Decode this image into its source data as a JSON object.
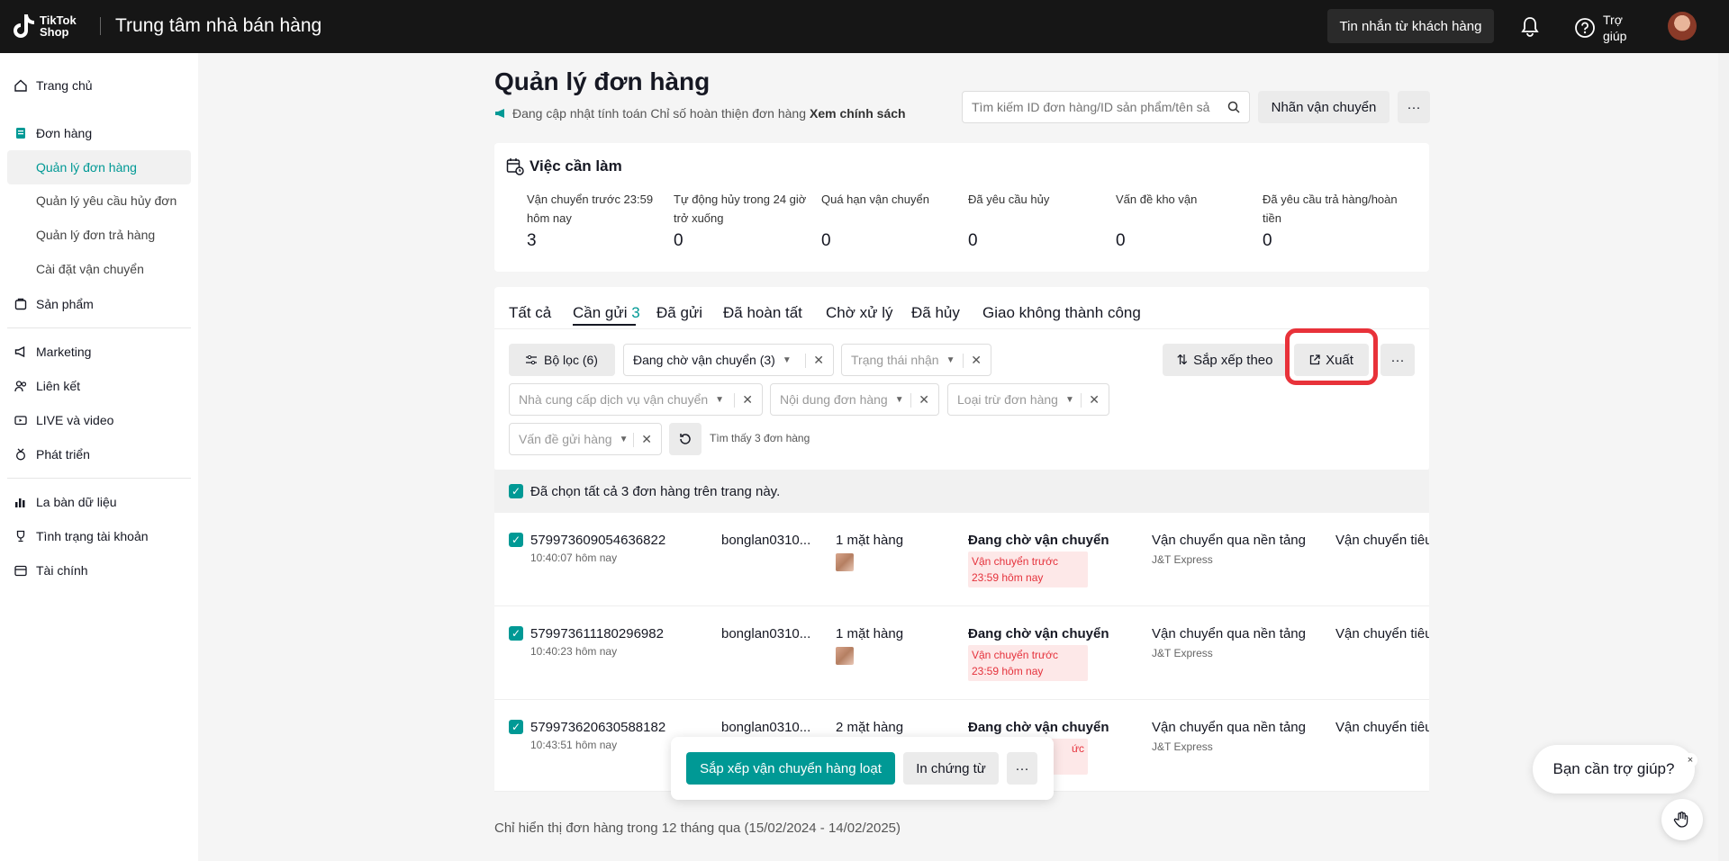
{
  "topbar": {
    "logo_line1": "TikTok",
    "logo_line2": "Shop",
    "title": "Trung tâm nhà bán hàng",
    "messages_button": "Tin nhắn từ khách hàng",
    "help_line1": "Trợ",
    "help_line2": "giúp"
  },
  "sidebar": {
    "home": "Trang chủ",
    "orders": "Đơn hàng",
    "order_sub": [
      "Quản lý đơn hàng",
      "Quản lý yêu cầu hủy đơn",
      "Quản lý đơn trả hàng",
      "Cài đặt vận chuyển"
    ],
    "products": "Sản phẩm",
    "marketing": "Marketing",
    "affiliate": "Liên kết",
    "live": "LIVE và video",
    "growth": "Phát triển",
    "data_compass": "La bàn dữ liệu",
    "account_health": "Tình trạng tài khoản",
    "finance": "Tài chính"
  },
  "header": {
    "title": "Quản lý đơn hàng",
    "notice": "Đang cập nhật tính toán Chỉ số hoàn thiện đơn hàng",
    "notice_link": "Xem chính sách",
    "search_placeholder": "Tìm kiếm ID đơn hàng/ID sản phẩm/tên sả",
    "shipping_label_button": "Nhãn vận chuyển",
    "more": "···"
  },
  "todo": {
    "title": "Việc cần làm",
    "stats": [
      {
        "label": "Vận chuyển trước 23:59 hôm nay",
        "value": "3"
      },
      {
        "label": "Tự động hủy trong 24 giờ trở xuống",
        "value": "0"
      },
      {
        "label": "Quá hạn vận chuyển",
        "value": "0"
      },
      {
        "label": "Đã yêu cầu hủy",
        "value": "0"
      },
      {
        "label": "Vấn đề kho vận",
        "value": "0"
      },
      {
        "label": "Đã yêu cầu trả hàng/hoàn tiền",
        "value": "0"
      }
    ]
  },
  "tabs": {
    "all": "Tất cả",
    "to_ship": "Cần gửi",
    "to_ship_count": "3",
    "shipped": "Đã gửi",
    "completed": "Đã hoàn tất",
    "pending": "Chờ xử lý",
    "cancelled": "Đã hủy",
    "failed": "Giao không thành công"
  },
  "filters": {
    "filter_button": "Bộ lọc",
    "filter_count": "(6)",
    "status_value": "Đang chờ vận chuyển (3)",
    "receive_status_ph": "Trạng thái nhận",
    "provider_ph": "Nhà cung cấp dịch vụ vận chuyển",
    "content_ph": "Nội dung đơn hàng",
    "exclude_ph": "Loại trừ đơn hàng",
    "ship_issue_ph": "Vấn đề gửi hàng",
    "found_text": "Tìm thấy 3 đơn hàng",
    "sort_button": "Sắp xếp theo",
    "export_button": "Xuất",
    "more": "···"
  },
  "selection_text": "Đã chọn tất cả 3 đơn hàng trên trang này.",
  "orders": [
    {
      "id": "579973609054636822",
      "time": "10:40:07 hôm nay",
      "buyer": "bonglan0310...",
      "items": "1 mặt hàng",
      "status": "Đang chờ vận chuyển",
      "deadline": "Vận chuyển trước 23:59 hôm nay",
      "shipping": "Vận chuyển qua nền tảng",
      "carrier": "J&T Express",
      "ship_type": "Vận chuyển tiêu"
    },
    {
      "id": "579973611180296982",
      "time": "10:40:23 hôm nay",
      "buyer": "bonglan0310...",
      "items": "1 mặt hàng",
      "status": "Đang chờ vận chuyển",
      "deadline": "Vận chuyển trước 23:59 hôm nay",
      "shipping": "Vận chuyển qua nền tảng",
      "carrier": "J&T Express",
      "ship_type": "Vận chuyển tiêu"
    },
    {
      "id": "579973620630588182",
      "time": "10:43:51 hôm nay",
      "buyer": "bonglan0310...",
      "items": "2 mặt hàng",
      "status": "Đang chờ vận chuyển",
      "deadline": "ức",
      "shipping": "Vận chuyển qua nền tảng",
      "carrier": "J&T Express",
      "ship_type": "Vận chuyển tiêu"
    }
  ],
  "bulk": {
    "arrange_button": "Sắp xếp vận chuyển hàng loạt",
    "print_button": "In chứng từ",
    "more": "···"
  },
  "footer_note": "Chỉ hiển thị đơn hàng trong 12 tháng qua (15/02/2024 - 14/02/2025)",
  "help_widget": {
    "text": "Bạn cần trợ giúp?",
    "close": "×"
  },
  "colors": {
    "accent": "#009995",
    "danger": "#e5323c",
    "topbar": "#161616",
    "highlight": "#e8323a"
  }
}
